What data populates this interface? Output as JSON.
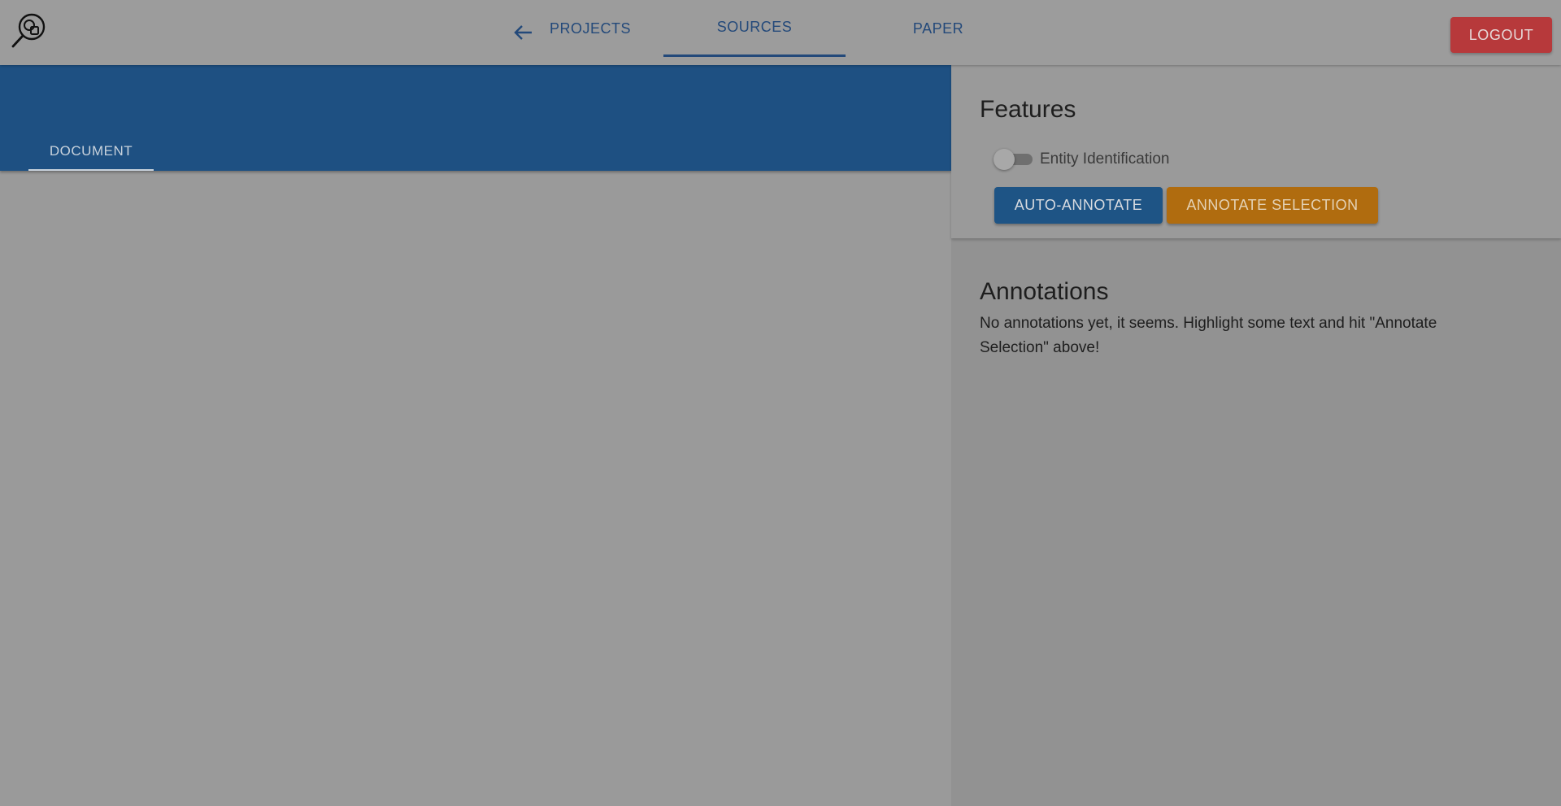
{
  "nav": {
    "back_icon": "arrow-left-icon",
    "tabs": [
      {
        "label": "PROJECTS"
      },
      {
        "label": "SOURCES",
        "active": true
      },
      {
        "label": "PAPER"
      }
    ],
    "logout_label": "LOGOUT"
  },
  "logo_icon": "magnifier-shapes-icon",
  "document": {
    "tab_label": "DOCUMENT"
  },
  "features": {
    "title": "Features",
    "toggle_label": "Entity Identification",
    "toggle_on": false,
    "auto_annotate_label": "AUTO-ANNOTATE",
    "annotate_selection_label": "ANNOTATE SELECTION"
  },
  "annotations": {
    "title": "Annotations",
    "empty_message": "No annotations yet, it seems. Highlight some text and hit \"Annotate Selection\" above!"
  },
  "colors": {
    "primary": "#1e5082",
    "warning": "#b06c0f",
    "danger": "#b7393b"
  }
}
